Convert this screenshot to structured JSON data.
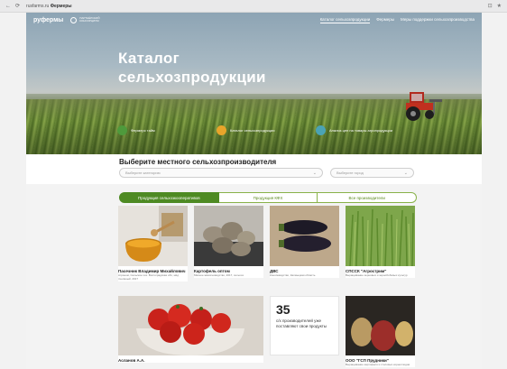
{
  "browser": {
    "url_prefix": "rusfarms.ru",
    "url_title": "Фермеры",
    "controls": [
      "⊡",
      "★"
    ]
  },
  "header": {
    "logo": "руфермы",
    "partner_logo_text": "ПАРТНЁРСКИЙ КОНСОРЦИУМ",
    "nav": [
      {
        "label": "Каталог сельхозпродукции",
        "active": true
      },
      {
        "label": "Фермеры",
        "active": false
      },
      {
        "label": "Меры поддержки сельхозпроизводства",
        "active": false
      }
    ]
  },
  "hero": {
    "title_line1": "Каталог",
    "title_line2": "сельхозпродукции",
    "features": [
      {
        "icon": "apple-icon",
        "color": "#4e9a3c",
        "label": "Фермерс тайм"
      },
      {
        "icon": "sun-icon",
        "color": "#e8a52a",
        "label": "Каталог сельхозпродукции"
      },
      {
        "icon": "map-icon",
        "color": "#4ba3b5",
        "label": "Анализ цен на товары агропродукции"
      }
    ]
  },
  "selector": {
    "title": "Выберите местного сельхозпроизводителя",
    "producer_placeholder": "Выберите категорию",
    "city_placeholder": "Выберите город"
  },
  "tabs": [
    {
      "label": "Продукция сельхозкооперативов",
      "active": true
    },
    {
      "label": "Продукция КФХ",
      "active": false
    },
    {
      "label": "Все производители",
      "active": false
    }
  ],
  "cards": [
    {
      "name": "Пасечник Владимир Михайлович",
      "desc": "Агроном, Сельское хоз. Волгоградская обл, мёд пчелиный, 2017"
    },
    {
      "name": "Картофель оптом",
      "desc": "Мясное животноводство, 2017, сельхоз"
    },
    {
      "name": "ДВС",
      "desc": "Конопеводство, Калмыцкая область"
    },
    {
      "name": "СПССК \"Агрострим\"",
      "desc": "Выращивание зерновых и зернобобовых культур"
    },
    {
      "name": "Асланов А.А.",
      "desc": "Выращивание овощей"
    },
    {
      "name": "ООО \"ГСП Прудники\"",
      "desc": "Выращивание картофеля и столовых корнеплодов"
    }
  ],
  "counter": {
    "number": "35",
    "text": "с/х производителей уже поставляют свои продукты"
  }
}
